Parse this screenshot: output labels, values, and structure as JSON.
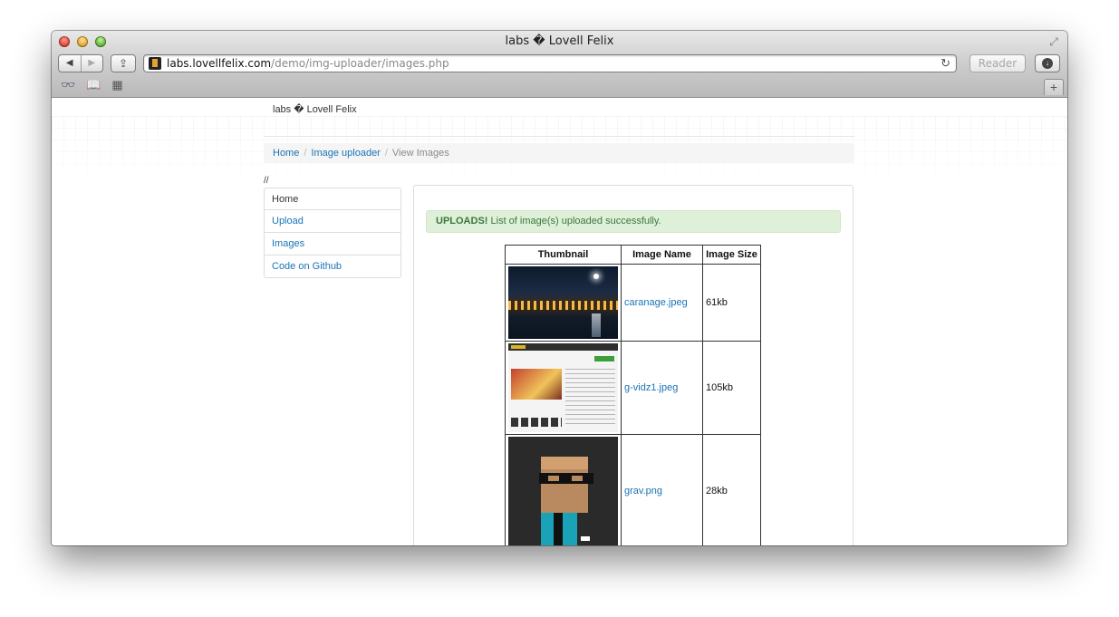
{
  "browser": {
    "window_title": "labs � Lovell Felix",
    "url_host": "labs.lovellfelix.com",
    "url_path": "/demo/img-uploader/images.php",
    "reader_label": "Reader"
  },
  "site": {
    "brand": "labs � Lovell Felix",
    "breadcrumb": {
      "home": "Home",
      "uploader": "Image uploader",
      "current": "View Images"
    },
    "comment_text": "//",
    "nav": {
      "home": "Home",
      "upload": "Upload",
      "images": "Images",
      "github": "Code on Github"
    }
  },
  "alert": {
    "strong": "UPLOADS!",
    "message": " List of image(s) uploaded successfully."
  },
  "table": {
    "headers": {
      "thumbnail": "Thumbnail",
      "name": "Image Name",
      "size": "Image Size"
    },
    "rows": [
      {
        "name": "caranage.jpeg",
        "size": "61kb"
      },
      {
        "name": "g-vidz1.jpeg",
        "size": "105kb"
      },
      {
        "name": "grav.png",
        "size": "28kb"
      }
    ]
  }
}
